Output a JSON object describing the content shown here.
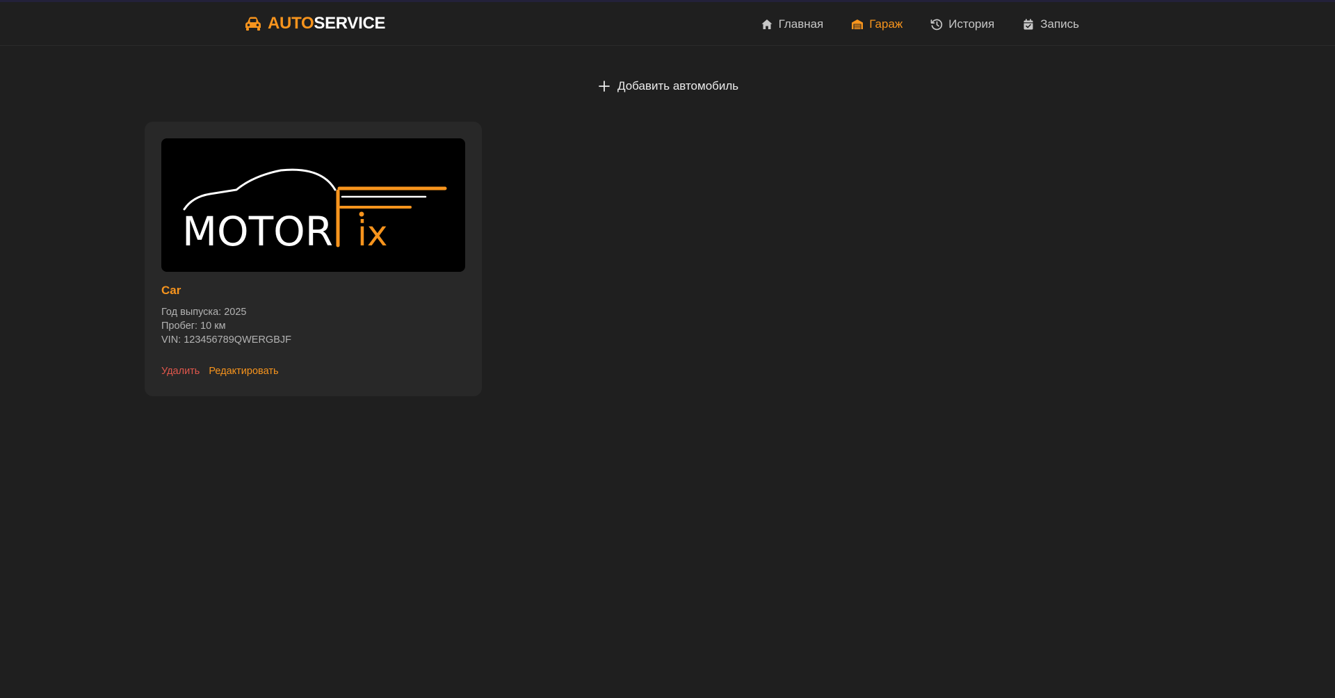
{
  "brand": {
    "part1": "AUTO",
    "part2": "SERVICE",
    "icon": "car-icon"
  },
  "nav": [
    {
      "label": "Главная",
      "icon": "home-icon",
      "active": false
    },
    {
      "label": "Гараж",
      "icon": "garage-icon",
      "active": true
    },
    {
      "label": "История",
      "icon": "history-icon",
      "active": false
    },
    {
      "label": "Запись",
      "icon": "calendar-icon",
      "active": false
    }
  ],
  "add_button": {
    "label": "Добавить автомобиль",
    "icon": "plus-icon"
  },
  "cars": [
    {
      "name": "Car",
      "year": "Год выпуска: 2025",
      "mileage": "Пробег: 10 км",
      "vin": "VIN: 123456789QWERGBJF",
      "logo": {
        "word1": "MOTOR",
        "word2": "ix"
      },
      "delete_label": "Удалить",
      "edit_label": "Редактировать"
    }
  ],
  "colors": {
    "accent": "#f7941d",
    "danger": "#e0574c",
    "background": "#1f1f1f",
    "card": "#282828"
  }
}
